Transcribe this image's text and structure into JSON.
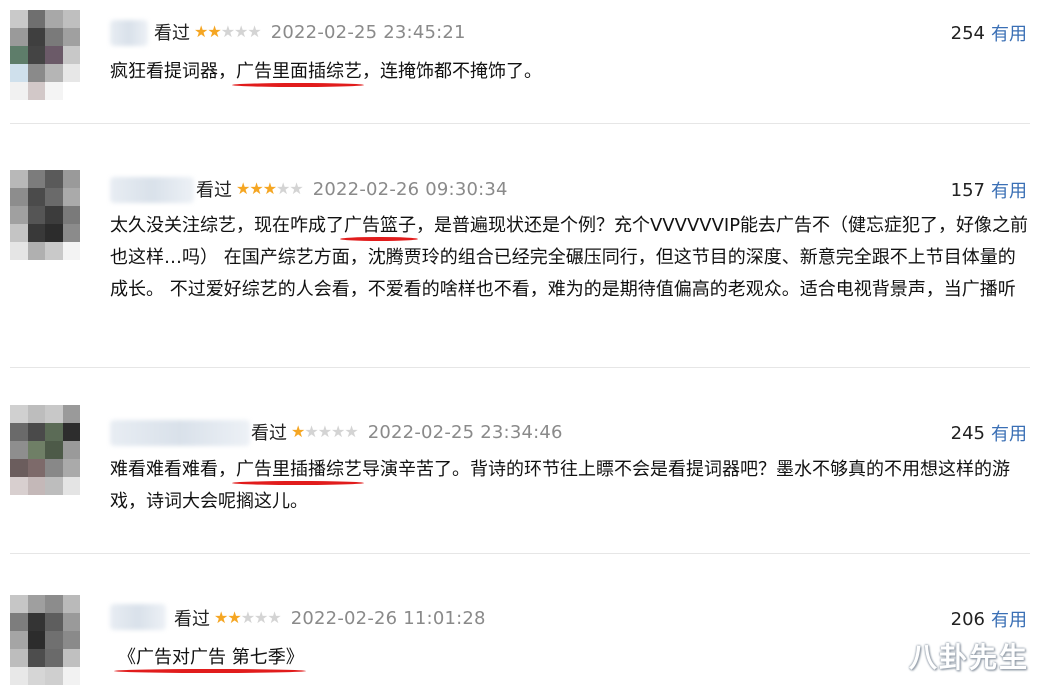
{
  "comments": [
    {
      "status": "看过",
      "rating": 2,
      "time": "2022-02-25 23:45:21",
      "votes": "254",
      "useful_label": "有用",
      "text_before": "疯狂看提词器，",
      "text_highlight": "广告里面插综艺",
      "text_after": "，连掩饰都不掩饰了。"
    },
    {
      "status": "看过",
      "rating": 3,
      "time": "2022-02-26 09:30:34",
      "votes": "157",
      "useful_label": "有用",
      "text_before": "太久没关注综艺，现在咋成了",
      "text_highlight": "广告篮子",
      "text_after": "，是普遍现状还是个例？充个VVVVVVIP能去广告不（健忘症犯了，好像之前也这样…吗） 在国产综艺方面，沈腾贾玲的组合已经完全碾压同行，但这节目的深度、新意完全跟不上节目体量的成长。 不过爱好综艺的人会看，不爱看的啥样也不看，难为的是期待值偏高的老观众。适合电视背景声，当广播听"
    },
    {
      "status": "看过",
      "rating": 1,
      "time": "2022-02-25 23:34:46",
      "votes": "245",
      "useful_label": "有用",
      "text_before": "难看难看难看，",
      "text_highlight": "广告里插播综艺",
      "text_after": "导演辛苦了。背诗的环节往上瞟不会是看提词器吧？墨水不够真的不用想这样的游戏，诗词大会呢搁这儿。"
    },
    {
      "status": "看过",
      "rating": 2,
      "time": "2022-02-26 11:01:28",
      "votes": "206",
      "useful_label": "有用",
      "text_before": "",
      "text_highlight": "《广告对广告 第七季》",
      "text_after": ""
    }
  ],
  "watermark": "八卦先生",
  "colors": {
    "star_on": "#f5a623",
    "star_off": "#d4d4d4",
    "useful_link": "#3a6fb5",
    "underline": "#e11c1c"
  }
}
